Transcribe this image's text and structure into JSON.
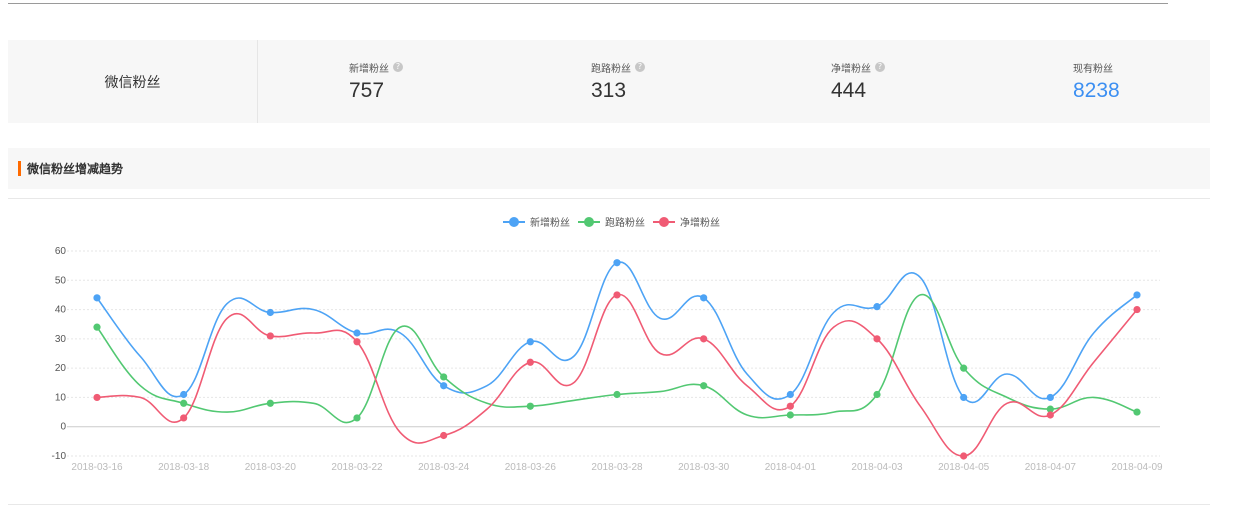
{
  "summary": {
    "name": "微信粉丝",
    "stats": [
      {
        "label": "新增粉丝",
        "value": "757",
        "help": "?"
      },
      {
        "label": "跑路粉丝",
        "value": "313",
        "help": "?"
      },
      {
        "label": "净增粉丝",
        "value": "444",
        "help": "?"
      },
      {
        "label": "现有粉丝",
        "value": "8238"
      }
    ]
  },
  "section": {
    "title": "微信粉丝增减趋势"
  },
  "colors": {
    "new": "#4da3f5",
    "lost": "#52c872",
    "net": "#f05b74",
    "accent": "#ff6a00",
    "highlight": "#3c8ff2"
  },
  "chart_data": {
    "type": "line",
    "title": "",
    "xlabel": "",
    "ylabel": "",
    "ylim": [
      -10,
      60
    ],
    "yticks": [
      60,
      50,
      40,
      30,
      20,
      10,
      0,
      -10
    ],
    "x_tick_labels": [
      "2018-03-16",
      "2018-03-18",
      "2018-03-20",
      "2018-03-22",
      "2018-03-24",
      "2018-03-26",
      "2018-03-28",
      "2018-03-30",
      "2018-04-01",
      "2018-04-03",
      "2018-04-05",
      "2018-04-07",
      "2018-04-09"
    ],
    "x": [
      "2018-03-16",
      "2018-03-17",
      "2018-03-18",
      "2018-03-19",
      "2018-03-20",
      "2018-03-21",
      "2018-03-22",
      "2018-03-23",
      "2018-03-24",
      "2018-03-25",
      "2018-03-26",
      "2018-03-27",
      "2018-03-28",
      "2018-03-29",
      "2018-03-30",
      "2018-03-31",
      "2018-04-01",
      "2018-04-02",
      "2018-04-03",
      "2018-04-04",
      "2018-04-05",
      "2018-04-06",
      "2018-04-07",
      "2018-04-08",
      "2018-04-09"
    ],
    "grid": true,
    "legend_position": "top-center",
    "series": [
      {
        "name": "新增粉丝",
        "color": "#4da3f5",
        "values": [
          44,
          24,
          11,
          42,
          39,
          40,
          32,
          32,
          14,
          14,
          29,
          24,
          56,
          37,
          44,
          18,
          11,
          39,
          41,
          51,
          10,
          18,
          10,
          32,
          45
        ]
      },
      {
        "name": "跑路粉丝",
        "color": "#52c872",
        "values": [
          34,
          14,
          8,
          5,
          8,
          8,
          3,
          34,
          17,
          8,
          7,
          9,
          11,
          12,
          14,
          4,
          4,
          5,
          11,
          45,
          20,
          10,
          6,
          10,
          5
        ]
      },
      {
        "name": "净增粉丝",
        "color": "#f05b74",
        "values": [
          10,
          10,
          3,
          37,
          31,
          32,
          29,
          -2,
          -3,
          6,
          22,
          15,
          45,
          25,
          30,
          14,
          7,
          34,
          30,
          7,
          -10,
          8,
          4,
          22,
          40
        ]
      }
    ],
    "markers_every": 2
  }
}
